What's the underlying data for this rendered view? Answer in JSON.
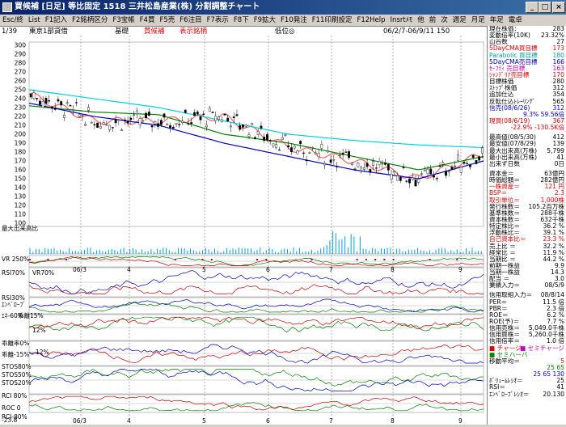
{
  "window": {
    "title": "買候補 [日足] 等比固定  1518  三井松島産業(株)  分割調整チャート",
    "minimize": "_",
    "maximize": "□",
    "close": "×"
  },
  "menu": [
    "Esc/終",
    "List",
    "F1記入",
    "F2銘柄区分",
    "F3宝帳",
    "F4買",
    "F5売",
    "F6注目",
    "F7表示",
    "F8下",
    "F9拡大",
    "F10発注",
    "F11印刷設定",
    "F12Help",
    "Insrtﾒﾓ",
    "他",
    "前",
    "次",
    "週足",
    "月足",
    "年足",
    "電卓"
  ],
  "info": {
    "page": "1/39",
    "market": "東京1部貸借",
    "base": "基礎",
    "candidate": "買候補",
    "display": "表示銘柄",
    "low": "低位◎",
    "range": "06/2/7-06/9/11 150"
  },
  "price_axis": [
    "300",
    "290",
    "280",
    "270",
    "260",
    "250",
    "240",
    "230",
    "220",
    "210",
    "200",
    "190",
    "180",
    "170",
    "160",
    "150",
    "140",
    "130",
    "120",
    "110",
    "100"
  ],
  "volume_label": "最大出来高比",
  "date_labels": [
    "06/3",
    "4",
    "5",
    "6",
    "7",
    "8",
    "9"
  ],
  "indicators": {
    "vr_label": "VR 250%",
    "vr_sub": "VR70%",
    "rsi_label": "RSI70%",
    "rsi30": "RSI30%",
    "rsi_sub": "ｴﾝﾍﾞﾛｰﾌﾟ",
    "env_label": "ｴﾈ-60%",
    "kairi_label": "乖離15%",
    "kairi_top": "12%",
    "kairi0": "乖離率0%",
    "kairim15": "乖離-15%",
    "kairi_12": "12%",
    "stos_labels": [
      "STOS80%",
      "STOS50%",
      "STOS20%"
    ],
    "rci_label": "RCI 80%",
    "rci_m80": "RCI-80%",
    "roc_label": "ROC 0",
    "roc_bottom": "-23.8"
  },
  "panel": {
    "rows1": [
      {
        "k": "現在株価：",
        "v": "283",
        "c": ""
      },
      {
        "k": "変動倍率(10K)",
        "v": "23.32%",
        "c": ""
      },
      {
        "k": "山谷数",
        "v": "27",
        "c": ""
      },
      {
        "k": "5DayCMA買目標",
        "v": "173",
        "c": "red"
      },
      {
        "k": "Parabolic 買目標",
        "v": "180",
        "c": "cyan"
      },
      {
        "k": "5DayCMA売目標",
        "v": "166",
        "c": "blue"
      },
      {
        "k": "ｾｰﾌﾃｨ 売目標",
        "v": "163",
        "c": "magenta"
      },
      {
        "k": "ｼｬﾝﾃﾞﾘｱ売目標",
        "v": "170",
        "c": "red"
      },
      {
        "k": "目標株価",
        "v": "280",
        "c": ""
      },
      {
        "k": "ｽﾄｯﾌﾟ株価",
        "v": "312",
        "c": ""
      },
      {
        "k": "追加仕込",
        "v": "354",
        "c": ""
      },
      {
        "k": "反転仕込ﾄﾚｰﾘﾝｸﾞ",
        "v": "565",
        "c": ""
      },
      {
        "k": "信売(08/6/26)",
        "v": "312",
        "c": "blue"
      },
      {
        "k": "",
        "v": "9.3%  59.56倍",
        "c": "blue"
      },
      {
        "k": "現買(08/6/19)",
        "v": "367",
        "c": "red"
      },
      {
        "k": "",
        "v": "-22.9%  -130.5K倍",
        "c": "red"
      }
    ],
    "rows2": [
      {
        "k": "最高値(08/5/30)",
        "v": "412",
        "c": ""
      },
      {
        "k": "最安値(07/8/29)",
        "v": "139",
        "c": ""
      },
      {
        "k": "最大出来高(万株)",
        "v": "5,799",
        "c": ""
      },
      {
        "k": "最小出来高(万株)",
        "v": "41",
        "c": ""
      },
      {
        "k": "出来ず日数",
        "v": "0日",
        "c": ""
      }
    ],
    "rows3": [
      {
        "k": "資本金＝",
        "v": "63億円",
        "c": ""
      },
      {
        "k": "時価総額＝",
        "v": "282億円",
        "c": ""
      },
      {
        "k": "一株資産＝",
        "v": "121 円",
        "c": "red"
      },
      {
        "k": "BSP＝",
        "v": "2.3",
        "c": "red"
      },
      {
        "k": "取引単位＝",
        "v": "1,000株",
        "c": "red"
      },
      {
        "k": "発行株数＝",
        "v": "105.2百万株",
        "c": ""
      },
      {
        "k": "基準株数＝",
        "v": "288千株",
        "c": ""
      },
      {
        "k": "資本株数＝",
        "v": "632千株",
        "c": ""
      },
      {
        "k": "特定株比＝",
        "v": "36.2 %",
        "c": ""
      },
      {
        "k": "浮動株比＝",
        "v": "39.1 %",
        "c": ""
      },
      {
        "k": "自己資本比＝",
        "v": "23.3 %",
        "c": "red"
      },
      {
        "k": "売上比 ＝",
        "v": "32.2 %",
        "c": ""
      },
      {
        "k": "経常比 ＝",
        "v": "11.9 %",
        "c": ""
      },
      {
        "k": "当期比 ＝",
        "v": "44.2 %",
        "c": ""
      },
      {
        "k": "前期一株益",
        "v": "9.9",
        "c": ""
      },
      {
        "k": "当期一株益",
        "v": "14.3",
        "c": ""
      },
      {
        "k": "配当 ＝",
        "v": "3.0",
        "c": ""
      },
      {
        "k": "業績入力＝",
        "v": "08/5/9",
        "c": ""
      }
    ],
    "rows4": [
      {
        "k": "信用取組入力＝",
        "v": "08/8/14",
        "c": ""
      },
      {
        "k": "PER＝",
        "v": "11.5 倍",
        "c": ""
      },
      {
        "k": "PBR＝",
        "v": "2.3 倍",
        "c": ""
      },
      {
        "k": "ROE＝",
        "v": "6.2 %",
        "c": ""
      },
      {
        "k": "ROE(予)＝",
        "v": "7.7 %",
        "c": ""
      },
      {
        "k": "信用売株＝",
        "v": "5,049.0千株",
        "c": ""
      },
      {
        "k": "信用買株＝",
        "v": "5,260.0千株",
        "c": ""
      },
      {
        "k": "信用倍率＝",
        "v": "1.0 倍",
        "c": ""
      }
    ],
    "legend_chart": "チャージ",
    "legend_chart2": "セミチャージ",
    "legend_chart3": "セミハーバ",
    "ma_label": "移動平均＝",
    "ma_values": [
      "5",
      "25 65",
      "25 65 130"
    ],
    "vol_ratio": "ﾎﾞﾘｭｰﾑﾚｼｵ＝",
    "vol_ratio_v": "25",
    "rsi": "RSI＝",
    "rsi_v": "41",
    "env": "ｴﾝﾍﾞﾛｰﾌﾟﾚｼｵ＝",
    "env_v": "20.130"
  },
  "colors": {
    "candle_up": "#ffffff",
    "candle_down": "#000000",
    "ma_short": "#e00000",
    "ma_mid": "#008000",
    "ma_long": "#0000c0",
    "ma_cyan": "#00d0e0",
    "band_red": "#ff6060",
    "band_blue": "#4040ff"
  },
  "chart_data": {
    "type": "line",
    "title": "",
    "ylim": [
      100,
      300
    ],
    "x": [
      "06/2/7",
      "06/3",
      "4",
      "5",
      "6",
      "7",
      "8",
      "06/9/11"
    ],
    "series": [
      {
        "values": [
          245,
          215,
          215,
          220,
          185,
          170,
          150,
          178
        ]
      },
      {
        "values": [
          232,
          225,
          222,
          200,
          190,
          175,
          160,
          175
        ]
      },
      {
        "values": [
          235,
          220,
          210,
          190,
          175,
          160,
          150,
          170
        ]
      },
      {
        "values": [
          250,
          240,
          230,
          215,
          200,
          193,
          188,
          185
        ]
      }
    ]
  }
}
